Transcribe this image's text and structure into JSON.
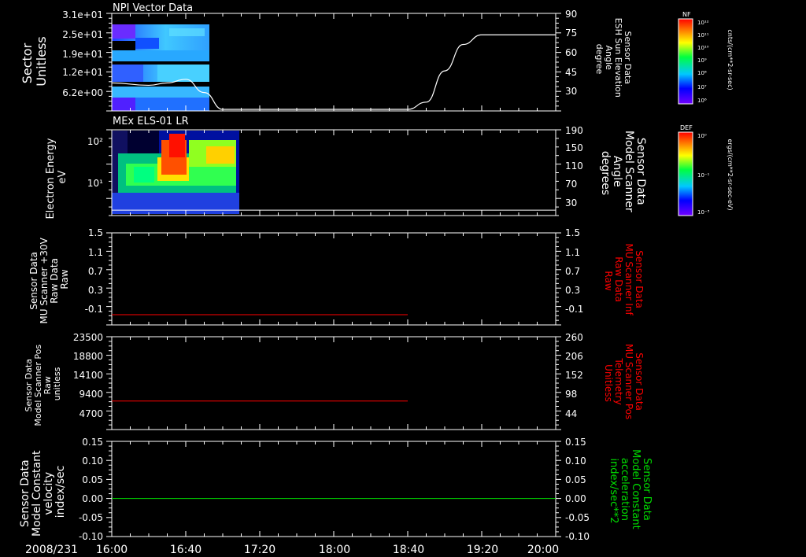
{
  "colors": {
    "background": "#000000",
    "frame": "#ffffff",
    "label_white": "#ffffff",
    "label_red": "#ff0000",
    "label_green": "#00dd00"
  },
  "time_axis": {
    "date_label": "2008/231",
    "ticks": [
      "16:00",
      "16:40",
      "17:20",
      "18:00",
      "18:40",
      "19:20",
      "20:00"
    ]
  },
  "panels": [
    {
      "title": "NPI Vector Data",
      "left_label": [
        "Sector",
        "Unitless"
      ],
      "left_ticks": [
        "3.1e+01",
        "2.5e+01",
        "1.9e+01",
        "1.2e+01",
        "6.2e+00"
      ],
      "right_label": [
        "Sensor Data",
        "ESH Sun Elevation",
        "Angle",
        "degree"
      ],
      "right_ticks": [
        "90",
        "75",
        "60",
        "45",
        "30"
      ],
      "right_label_color": "#ffffff",
      "colorbar": {
        "title": "NF",
        "unit_label": "cnts/(cm**2-sr-sec)",
        "ticks": [
          "10¹²",
          "10¹¹",
          "10¹⁰",
          "10⁹",
          "10⁸",
          "10⁷",
          "10⁶"
        ]
      }
    },
    {
      "title": "MEx ELS-01 LR",
      "left_label": [
        "Electron Energy",
        "eV"
      ],
      "left_ticks": [
        "10²",
        "10¹"
      ],
      "right_label": [
        "Sensor Data",
        "Model Scanner",
        "Angle",
        "degrees"
      ],
      "right_ticks": [
        "190",
        "150",
        "110",
        "70",
        "30"
      ],
      "right_label_color": "#ffffff",
      "colorbar": {
        "title": "DEF",
        "unit_label": "ergs/(cm**2-sr-sec-eV)",
        "ticks": [
          "10⁰",
          "10⁻¹",
          "10⁻³"
        ]
      }
    },
    {
      "title": "",
      "left_label": [
        "Sensor Data",
        "MU Scanner +30V",
        "Raw Data",
        "Raw"
      ],
      "left_ticks": [
        "1.5",
        "1.1",
        "0.7",
        "0.3",
        "-0.1"
      ],
      "right_label": [
        "Sensor Data",
        "MU Scanner Inf",
        "Raw Data",
        "Raw"
      ],
      "right_ticks": [
        "1.5",
        "1.1",
        "0.7",
        "0.3",
        "-0.1"
      ],
      "right_label_color": "#ff0000"
    },
    {
      "title": "",
      "left_label": [
        "Sensor Data",
        "Model Scanner Pos",
        "Raw",
        "unitless"
      ],
      "left_ticks": [
        "23500",
        "18800",
        "14100",
        "9400",
        "4700"
      ],
      "right_label": [
        "Sensor Data",
        "MU Scanner Pos",
        "Telemetry",
        "Unitless"
      ],
      "right_ticks": [
        "260",
        "206",
        "152",
        "98",
        "44"
      ],
      "right_label_color": "#ff0000"
    },
    {
      "title": "",
      "left_label": [
        "Sensor Data",
        "Model Constant",
        "velocity",
        "index/sec"
      ],
      "left_ticks": [
        "0.15",
        "0.10",
        "0.05",
        "0.00",
        "-0.05",
        "-0.10"
      ],
      "right_label": [
        "Sensor Data",
        "Model Constant",
        "acceleration",
        "index/sec**2"
      ],
      "right_ticks": [
        "0.15",
        "0.10",
        "0.05",
        "0.00",
        "-0.05",
        "-0.10"
      ],
      "right_label_color": "#00dd00"
    }
  ],
  "chart_data": [
    {
      "type": "line",
      "title": "NPI Vector Data",
      "xlabel": "",
      "ylabel": "Sector Unitless",
      "y2label": "Sensor Data ESH Sun Elevation Angle degree",
      "x": [
        "16:00",
        "16:20",
        "16:30",
        "16:40",
        "16:50",
        "17:00",
        "17:20",
        "18:00",
        "18:40",
        "18:50",
        "19:00",
        "19:10",
        "19:20",
        "20:00"
      ],
      "series": [
        {
          "name": "Sensor Data ESH Sun Elevation Angle",
          "axis": "right",
          "color": "#ffffff",
          "values": [
            40,
            38,
            40,
            43,
            32,
            18,
            18,
            18,
            18,
            24,
            50,
            72,
            80,
            80
          ]
        }
      ],
      "y2lim": [
        18,
        90
      ],
      "spectrogram_time_range": [
        "16:00",
        "16:55"
      ],
      "colorbar": {
        "label": "NF",
        "scale": "log",
        "range": [
          "1e6",
          "1e12"
        ]
      }
    },
    {
      "type": "heatmap",
      "title": "MEx ELS-01 LR",
      "ylabel": "Electron Energy eV",
      "yscale": "log",
      "y2label": "Sensor Data Model Scanner Angle degrees",
      "data_time_range": [
        "16:00",
        "17:00"
      ],
      "series": [
        {
          "name": "Sensor Data Model Scanner Angle",
          "axis": "right",
          "color": "#ffffff",
          "x": [
            "16:00",
            "20:00"
          ],
          "values": [
            12,
            12
          ]
        }
      ],
      "y2lim": [
        0,
        190
      ],
      "colorbar": {
        "label": "DEF",
        "scale": "log"
      }
    },
    {
      "type": "line",
      "ylabel": "Sensor Data MU Scanner +30V Raw Data Raw",
      "ylim": [
        -0.3,
        1.5
      ],
      "series": [
        {
          "name": "Sensor Data MU Scanner Inf Raw Data",
          "color": "#ff0000",
          "x": [
            "16:00",
            "18:40"
          ],
          "values": [
            -0.1,
            -0.1
          ]
        }
      ]
    },
    {
      "type": "line",
      "ylabel": "Sensor Data Model Scanner Pos Raw unitless",
      "ylim": [
        0,
        23500
      ],
      "y2lim": [
        0,
        260
      ],
      "series": [
        {
          "name": "Sensor Data MU Scanner Pos Telemetry",
          "axis": "right",
          "color": "#ff0000",
          "x": [
            "16:00",
            "18:40"
          ],
          "values": [
            80,
            80
          ]
        }
      ]
    },
    {
      "type": "line",
      "ylabel": "Sensor Data Model Constant velocity index/sec",
      "ylim": [
        -0.1,
        0.15
      ],
      "series": [
        {
          "name": "Sensor Data Model Constant acceleration",
          "color": "#00dd00",
          "x": [
            "16:00",
            "20:00"
          ],
          "values": [
            0.0,
            0.0
          ]
        }
      ]
    }
  ]
}
